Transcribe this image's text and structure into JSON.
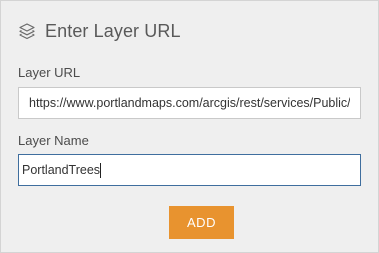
{
  "dialog": {
    "title": "Enter Layer URL",
    "title_icon": "layers-icon"
  },
  "layer_url": {
    "label": "Layer URL",
    "value": "https://www.portlandmaps.com/arcgis/rest/services/Public/"
  },
  "layer_name": {
    "label": "Layer Name",
    "value": "PortlandTrees"
  },
  "add_button": {
    "label": "ADD",
    "color": "#e8932f"
  }
}
